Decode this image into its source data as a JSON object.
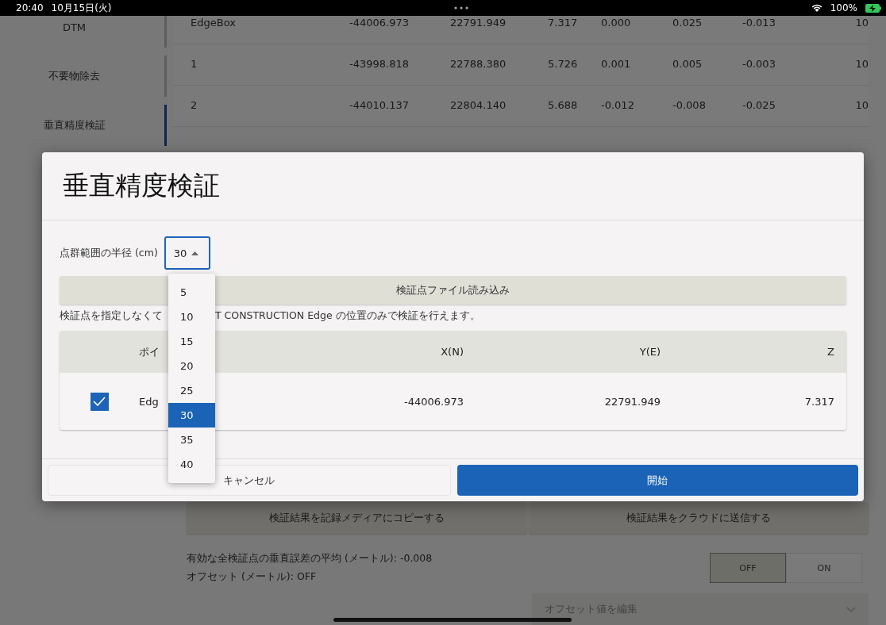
{
  "status_bar": {
    "time": "20:40",
    "date": "10月15日(火)",
    "battery": "100%"
  },
  "sidebar": {
    "items": [
      {
        "label": "DTM",
        "selected": false
      },
      {
        "label": "不要物除去",
        "selected": false
      },
      {
        "label": "垂直精度検証",
        "selected": true
      }
    ]
  },
  "results_table": {
    "rows": [
      {
        "cells": [
          "EdgeBox",
          "-44006.973",
          "22791.949",
          "7.317",
          "0.000",
          "0.025",
          "-0.013",
          "10"
        ]
      },
      {
        "cells": [
          "1",
          "-43998.818",
          "22788.380",
          "5.726",
          "0.001",
          "0.005",
          "-0.003",
          "10"
        ]
      },
      {
        "cells": [
          "2",
          "-44010.137",
          "22804.140",
          "5.688",
          "-0.012",
          "-0.008",
          "-0.025",
          "10"
        ]
      }
    ]
  },
  "actions": [
    "検証結果を記録メディアにコピーする",
    "検証結果をクラウドに送信する"
  ],
  "summary": [
    "有効な全検証点の垂直誤差の平均 (メートル): -0.008",
    "オフセット (メートル): OFF"
  ],
  "offset_toggle": [
    {
      "label": "OFF",
      "selected": true
    },
    {
      "label": "ON",
      "selected": false
    }
  ],
  "offset_edit": {
    "label": "オフセット値を編集",
    "disabled": true
  },
  "dialog": {
    "title": "垂直精度検証",
    "radius": {
      "label": "点群範囲の半径 (cm)",
      "value": "30",
      "expanded": true
    },
    "options": [
      {
        "label": "5",
        "selected": false
      },
      {
        "label": "10",
        "selected": false
      },
      {
        "label": "15",
        "selected": false
      },
      {
        "label": "20",
        "selected": false
      },
      {
        "label": "25",
        "selected": false
      },
      {
        "label": "30",
        "selected": true
      },
      {
        "label": "35",
        "selected": false
      },
      {
        "label": "40",
        "selected": false
      }
    ],
    "load_button": "検証点ファイル読み込み",
    "note": [
      "検証点を指定しなくて",
      "T CONSTRUCTION Edge の位置のみで検証を行えます。"
    ],
    "points_table": {
      "columns": [
        "ポイ",
        "X(N)",
        "Y(E)",
        "Z"
      ],
      "rows": [
        {
          "checked": true,
          "cells": [
            "Edg",
            "-44006.973",
            "22791.949",
            "7.317"
          ]
        }
      ]
    },
    "buttons": [
      {
        "label": "キャンセル",
        "kind": "secondary"
      },
      {
        "label": "開始",
        "kind": "primary"
      }
    ]
  }
}
